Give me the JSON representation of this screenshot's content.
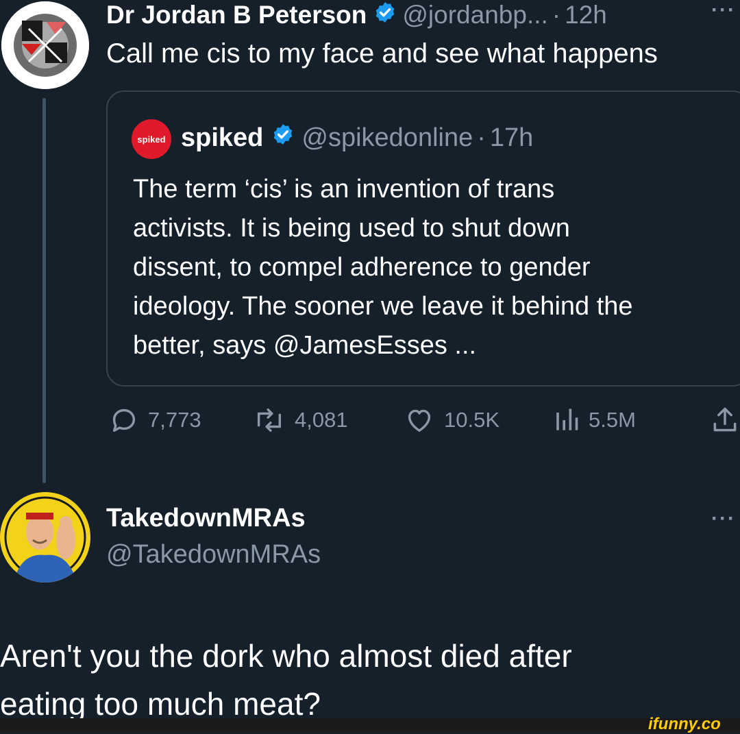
{
  "tweet": {
    "author_name": "Dr Jordan B Peterson",
    "handle": "@jordanbp...",
    "separator": "·",
    "time": "12h",
    "text": "Call me cis to my face and see what happens"
  },
  "quoted_tweet": {
    "avatar_text": "spiked",
    "author_name": "spiked",
    "handle": "@spikedonline",
    "separator": "·",
    "time": "17h",
    "text_lines": [
      "The term ‘cis’ is an invention of trans",
      "activists. It is being used to shut down",
      "dissent, to compel adherence to gender",
      "ideology. The sooner we leave it behind the",
      "better, says @JamesEsses ..."
    ]
  },
  "actions": {
    "replies": "7,773",
    "retweets": "4,081",
    "likes": "10.5K",
    "views": "5.5M"
  },
  "reply": {
    "author_name": "TakedownMRAs",
    "handle": "@TakedownMRAs",
    "text_lines": [
      "Aren't you the dork who almost died after",
      "eating too much meat?"
    ]
  },
  "watermark": "ifunny.co",
  "colors": {
    "background": "#15202b",
    "verified": "#1d9bf0",
    "muted": "#8b98a5",
    "border": "#38444d",
    "spiked_red": "#e0192b",
    "watermark_yellow": "#ffcc00"
  }
}
